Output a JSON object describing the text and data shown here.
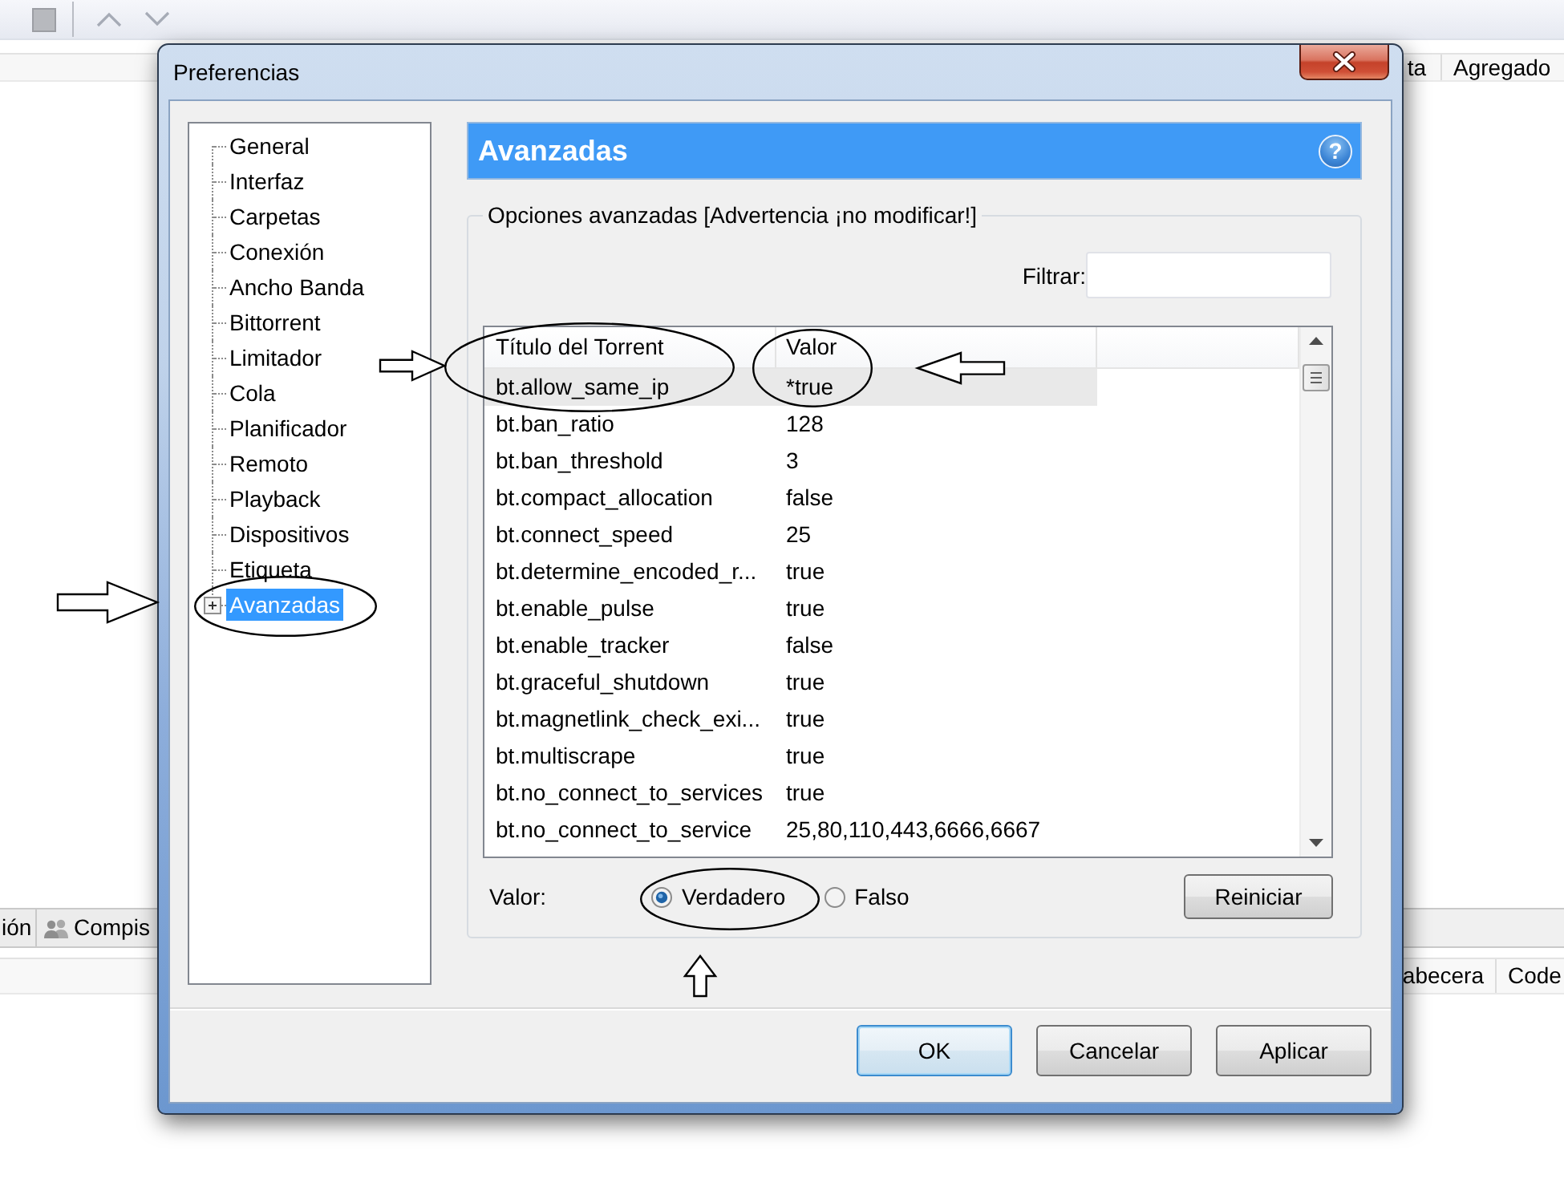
{
  "background_app": {
    "column_headers": [
      "ta",
      "Agregado"
    ],
    "tabs": [
      {
        "label": "ión",
        "selected": false
      },
      {
        "label": "Compis",
        "selected": false
      }
    ],
    "lower_column_headers": [
      "abecera",
      "Code"
    ]
  },
  "dialog": {
    "title": "Preferencias",
    "sidebar": {
      "items": [
        {
          "label": "General",
          "selected": false
        },
        {
          "label": "Interfaz",
          "selected": false
        },
        {
          "label": "Carpetas",
          "selected": false
        },
        {
          "label": "Conexión",
          "selected": false
        },
        {
          "label": "Ancho Banda",
          "selected": false
        },
        {
          "label": "Bittorrent",
          "selected": false
        },
        {
          "label": "Limitador",
          "selected": false
        },
        {
          "label": "Cola",
          "selected": false
        },
        {
          "label": "Planificador",
          "selected": false
        },
        {
          "label": "Remoto",
          "selected": false
        },
        {
          "label": "Playback",
          "selected": false
        },
        {
          "label": "Dispositivos",
          "selected": false
        },
        {
          "label": "Etiqueta",
          "selected": false
        },
        {
          "label": "Avanzadas",
          "selected": true,
          "expanded": false
        }
      ]
    },
    "panel": {
      "title": "Avanzadas",
      "help_button": "?",
      "group_title": "Opciones avanzadas [Advertencia ¡no modificar!]",
      "filter": {
        "label": "Filtrar:"
      },
      "table": {
        "columns": [
          "Título del Torrent",
          "Valor"
        ],
        "rows": [
          {
            "name": "bt.allow_same_ip",
            "value": "*true",
            "selected": true
          },
          {
            "name": "bt.ban_ratio",
            "value": "128",
            "selected": false
          },
          {
            "name": "bt.ban_threshold",
            "value": "3",
            "selected": false
          },
          {
            "name": "bt.compact_allocation",
            "value": "false",
            "selected": false
          },
          {
            "name": "bt.connect_speed",
            "value": "25",
            "selected": false
          },
          {
            "name": "bt.determine_encoded_r...",
            "value": "true",
            "selected": false
          },
          {
            "name": "bt.enable_pulse",
            "value": "true",
            "selected": false
          },
          {
            "name": "bt.enable_tracker",
            "value": "false",
            "selected": false
          },
          {
            "name": "bt.graceful_shutdown",
            "value": "true",
            "selected": false
          },
          {
            "name": "bt.magnetlink_check_exi...",
            "value": "true",
            "selected": false
          },
          {
            "name": "bt.multiscrape",
            "value": "true",
            "selected": false
          },
          {
            "name": "bt.no_connect_to_services",
            "value": "true",
            "selected": false
          },
          {
            "name": "bt.no_connect_to_service",
            "value": "25,80,110,443,6666,6667",
            "selected": false
          }
        ]
      },
      "value": {
        "label": "Valor:",
        "options": [
          {
            "label": "Verdadero",
            "selected": true
          },
          {
            "label": "Falso",
            "selected": false
          }
        ]
      },
      "reset_button": "Reiniciar"
    },
    "buttons": [
      {
        "label": "OK",
        "default": true
      },
      {
        "label": "Cancelar",
        "default": false
      },
      {
        "label": "Aplicar",
        "default": false
      }
    ]
  },
  "annotations": [
    {
      "kind": "right-arrow"
    },
    {
      "kind": "ellipse"
    },
    {
      "kind": "ellipse"
    },
    {
      "kind": "left-arrow"
    },
    {
      "kind": "right-arrow"
    },
    {
      "kind": "ellipse"
    },
    {
      "kind": "ellipse"
    },
    {
      "kind": "up-arrow"
    }
  ]
}
